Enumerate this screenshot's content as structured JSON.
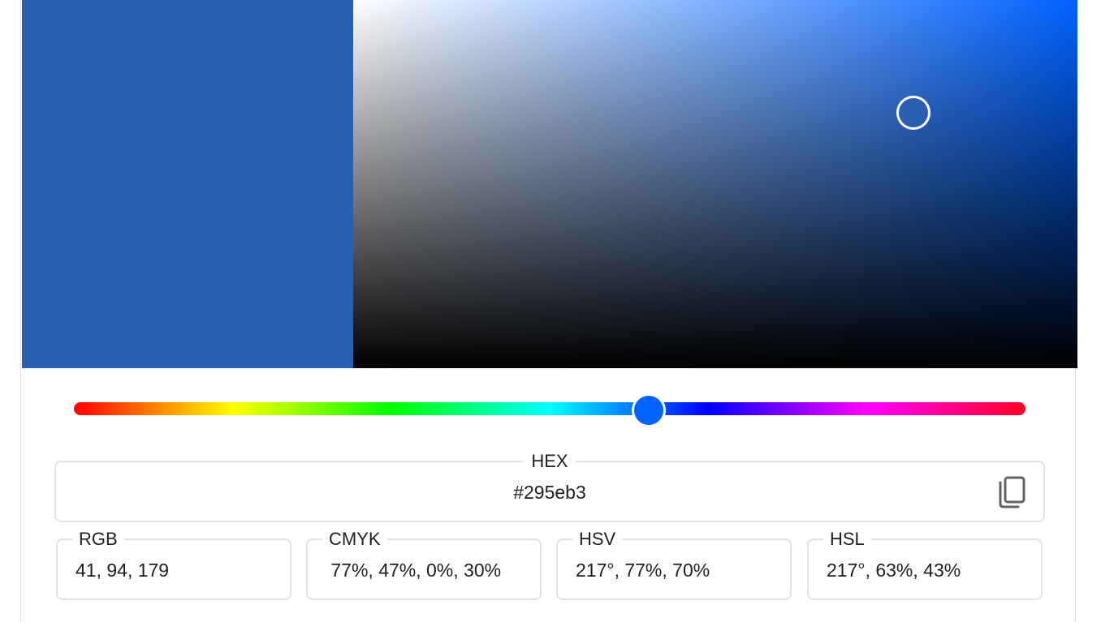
{
  "colors": {
    "selected": "#295eb3",
    "hue_pure": "#0062ff"
  },
  "hue_position": 0.6028,
  "hex": {
    "label": "HEX",
    "value": "#295eb3",
    "copy_icon": "copy-icon"
  },
  "formats": [
    {
      "label": "RGB",
      "value": "41, 94, 179"
    },
    {
      "label": "CMYK",
      "value": " 77%, 47%, 0%, 30%"
    },
    {
      "label": "HSV",
      "value": "217°, 77%, 70%"
    },
    {
      "label": "HSL",
      "value": "217°, 63%, 43%"
    }
  ]
}
